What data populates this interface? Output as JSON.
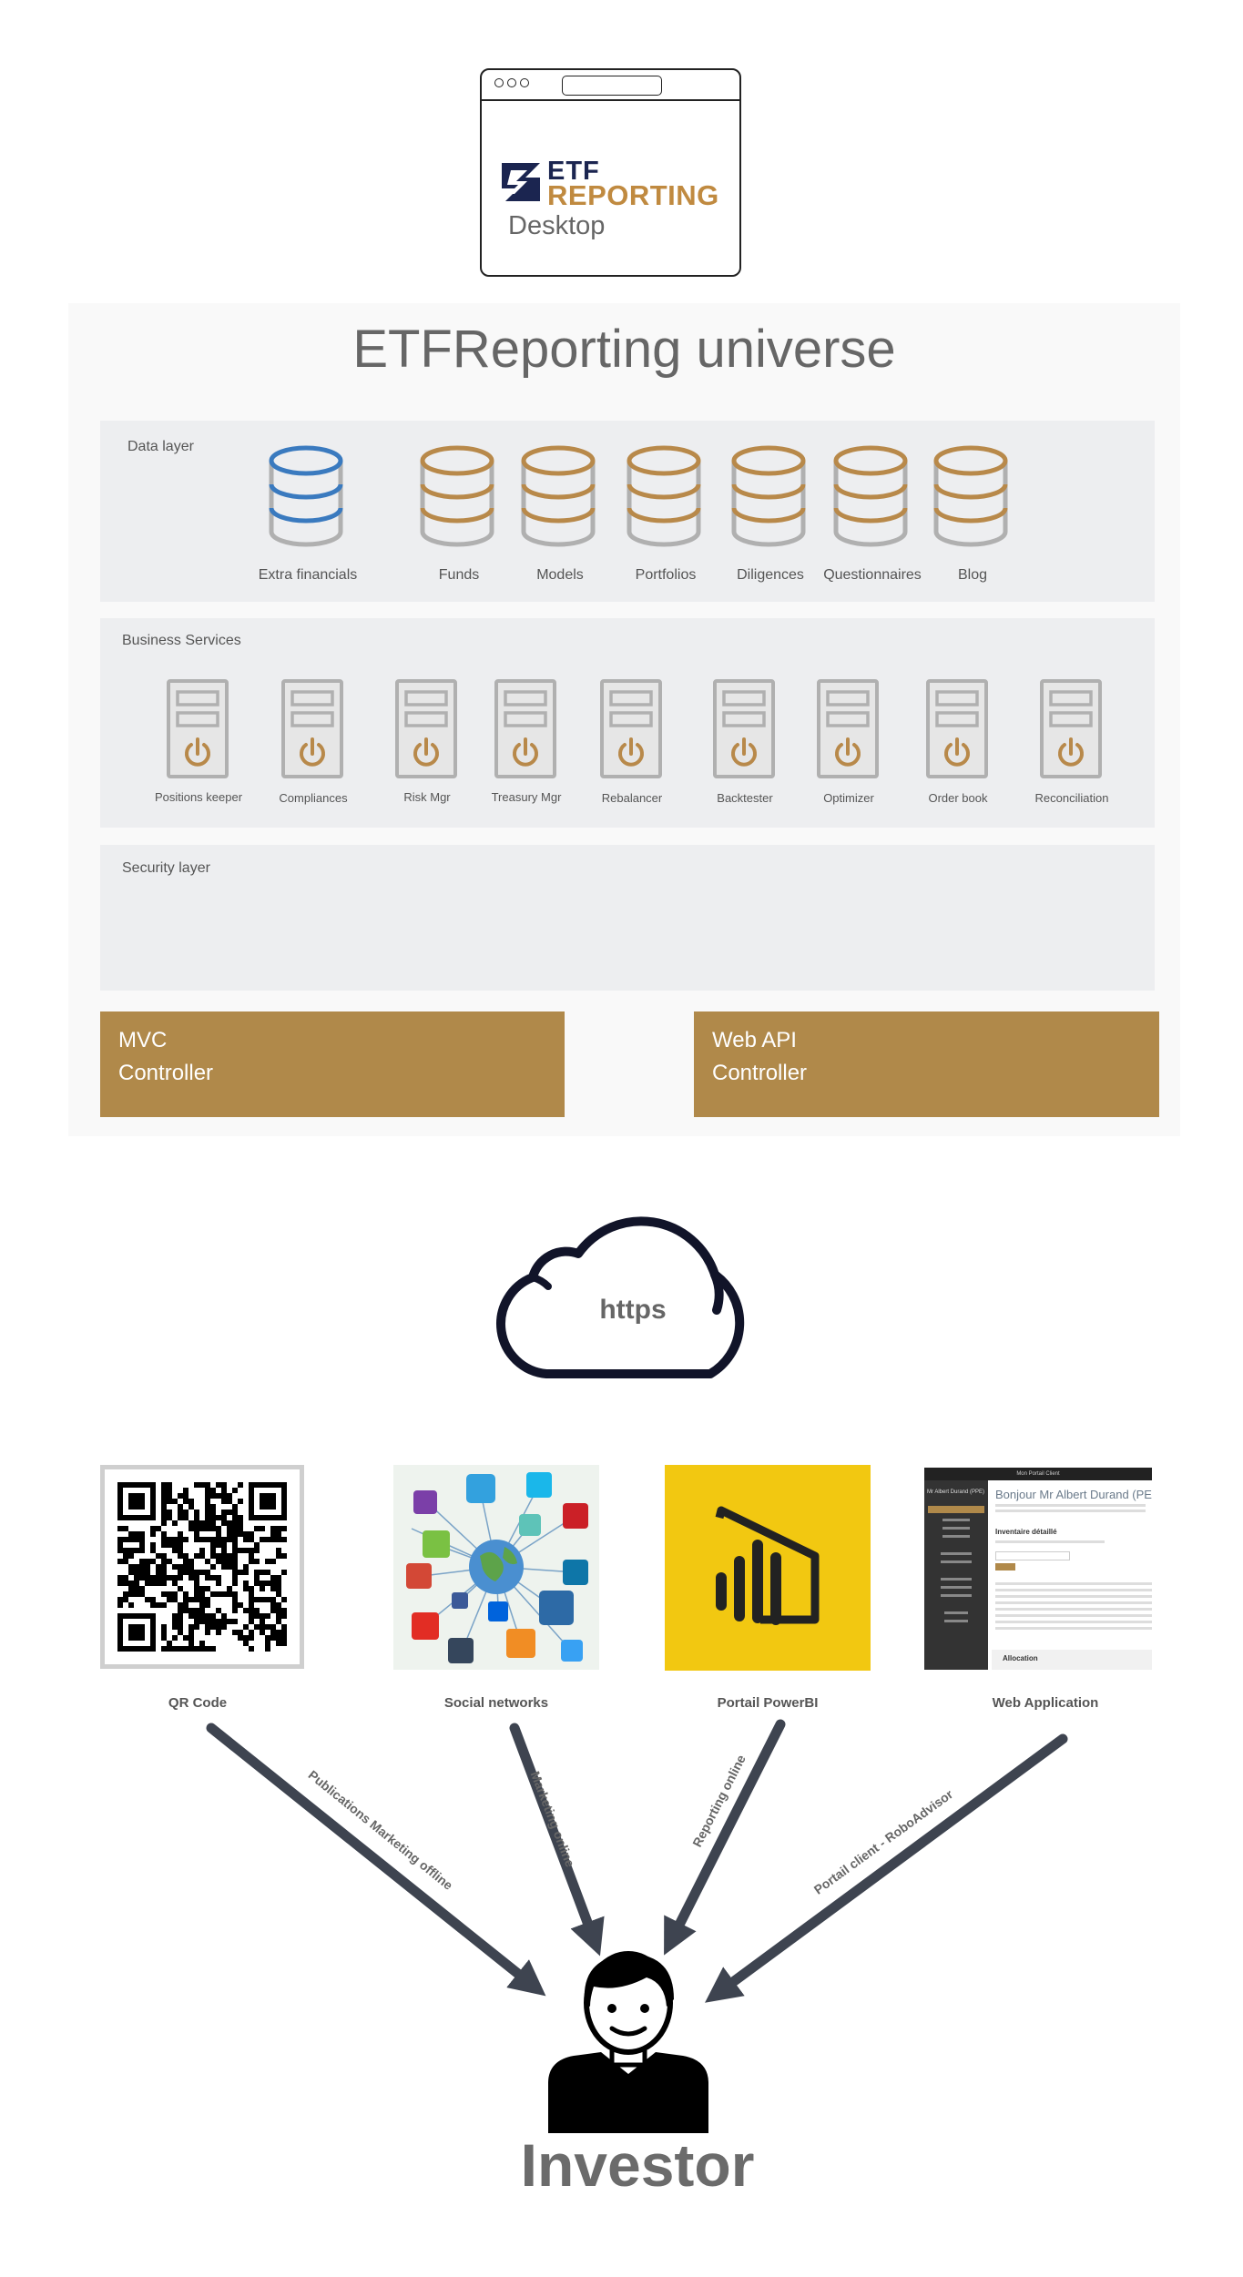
{
  "desktop": {
    "brand_line1": "ETF",
    "brand_line2": "REPORTING",
    "label": "Desktop"
  },
  "universe": {
    "title": "ETFReporting universe",
    "data_layer": {
      "label": "Data layer",
      "stores": [
        "Extra financials",
        "Funds",
        "Models",
        "Portfolios",
        "Diligences",
        "Questionnaires",
        "Blog"
      ]
    },
    "business_services": {
      "label": "Business Services",
      "services": [
        "Positions keeper",
        "Compliances",
        "Risk Mgr",
        "Treasury Mgr",
        "Rebalancer",
        "Backtester",
        "Optimizer",
        "Order book",
        "Reconciliation"
      ]
    },
    "security_layer": {
      "label": "Security layer"
    },
    "controllers": {
      "mvc": {
        "line1": "MVC",
        "line2": "Controller"
      },
      "webapi": {
        "line1": "Web API",
        "line2": "Controller"
      }
    }
  },
  "cloud": {
    "label": "https"
  },
  "channels": [
    {
      "label": "QR Code",
      "arrow_label": "Publications Marketing offline"
    },
    {
      "label": "Social networks",
      "arrow_label": "Marketing online"
    },
    {
      "label": "Portail PowerBI",
      "arrow_label": "Reporting online"
    },
    {
      "label": "Web Application",
      "arrow_label": "Portail client - RoboAdvisor"
    }
  ],
  "webapp_preview": {
    "topbar": "Mon Portail Client",
    "user": "Mr Albert Durand (PPE)",
    "greeting": "Bonjour Mr Albert Durand (PE",
    "section": "Inventaire détaillé",
    "section2": "Allocation"
  },
  "investor": {
    "label": "Investor"
  },
  "colors": {
    "accent": "#b0894a",
    "db_blue": "#3a7abf",
    "db_gold": "#b8894a",
    "arrow": "#3e4450",
    "powerbi_bg": "#f2c811",
    "brand_navy": "#1b2550"
  }
}
